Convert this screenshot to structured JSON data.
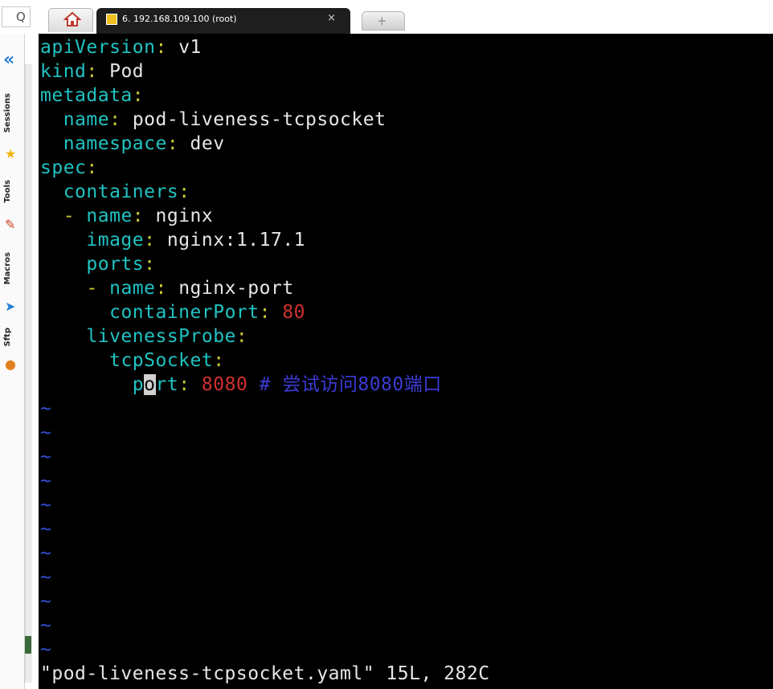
{
  "window": {
    "search_glyph": "Q",
    "tabs": {
      "home_icon": "home-icon",
      "session_title": "6. 192.168.109.100 (root)",
      "close_label": "×",
      "new_tab_label": "+"
    }
  },
  "sidebar": {
    "collapse_label": "«",
    "items": [
      {
        "label": "Sessions",
        "icon": "star-icon"
      },
      {
        "label": "Tools",
        "icon": "tools-icon"
      },
      {
        "label": "Macros",
        "icon": "macro-arrow-icon"
      },
      {
        "label": "Sftp",
        "icon": "sftp-icon"
      }
    ]
  },
  "terminal": {
    "colors": {
      "key": "#21c3c3",
      "colon": "#c9c932",
      "value": "#e6e6e6",
      "number": "#d03030",
      "comment": "#3b3bd6",
      "tilde": "#3050d8",
      "background": "#000000"
    },
    "lines": [
      {
        "indent": "",
        "dash": "",
        "key": "apiVersion",
        "value": "v1"
      },
      {
        "indent": "",
        "dash": "",
        "key": "kind",
        "value": "Pod"
      },
      {
        "indent": "",
        "dash": "",
        "key": "metadata",
        "value": ""
      },
      {
        "indent": "  ",
        "dash": "",
        "key": "name",
        "value": "pod-liveness-tcpsocket"
      },
      {
        "indent": "  ",
        "dash": "",
        "key": "namespace",
        "value": "dev"
      },
      {
        "indent": "",
        "dash": "",
        "key": "spec",
        "value": ""
      },
      {
        "indent": "  ",
        "dash": "",
        "key": "containers",
        "value": ""
      },
      {
        "indent": "  ",
        "dash": "- ",
        "key": "name",
        "value": "nginx"
      },
      {
        "indent": "    ",
        "dash": "",
        "key": "image",
        "value": "nginx:1.17.1"
      },
      {
        "indent": "    ",
        "dash": "",
        "key": "ports",
        "value": ""
      },
      {
        "indent": "    ",
        "dash": "- ",
        "key": "name",
        "value": "nginx-port"
      },
      {
        "indent": "      ",
        "dash": "",
        "key": "containerPort",
        "number": "80"
      },
      {
        "indent": "    ",
        "dash": "",
        "key": "livenessProbe",
        "value": ""
      },
      {
        "indent": "      ",
        "dash": "",
        "key": "tcpSocket",
        "value": ""
      },
      {
        "indent": "        ",
        "dash": "",
        "key": "port",
        "number": "8080",
        "comment": "# 尝试访问8080端口",
        "cursor_index": 1
      }
    ],
    "tilde_char": "~",
    "tilde_count": 11,
    "status_line": "\"pod-liveness-tcpsocket.yaml\" 15L, 282C"
  }
}
